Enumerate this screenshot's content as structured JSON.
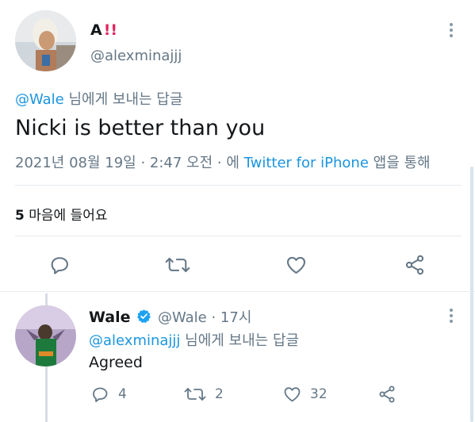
{
  "tweet": {
    "author_name": "A",
    "author_badge": "‼️",
    "author_handle": "@alexminajjj",
    "reply_to_handle": "@Wale",
    "reply_to_suffix": " 님에게 보내는 답글",
    "text": "Nicki is better than you",
    "timestamp": "2021년 08월 19일 · 2:47 오전 · 에 ",
    "source": "Twitter for iPhone",
    "source_suffix": " 앱을 통해",
    "likes_count": "5",
    "likes_label": " 마음에 들어요"
  },
  "reply": {
    "author_name": "Wale",
    "author_handle": "@Wale",
    "time": " · 17시",
    "reply_to_handle": "@alexminajjj",
    "reply_to_suffix": " 님에게 보내는 답글",
    "text": "Agreed",
    "comments": "4",
    "retweets": "2",
    "likes": "32"
  },
  "icons": [
    "more-icon",
    "reply-icon",
    "retweet-icon",
    "like-icon",
    "share-icon",
    "verified-icon"
  ],
  "colors": {
    "accent": "#1b95e0",
    "muted": "#657786",
    "badge": "#e0245e"
  }
}
